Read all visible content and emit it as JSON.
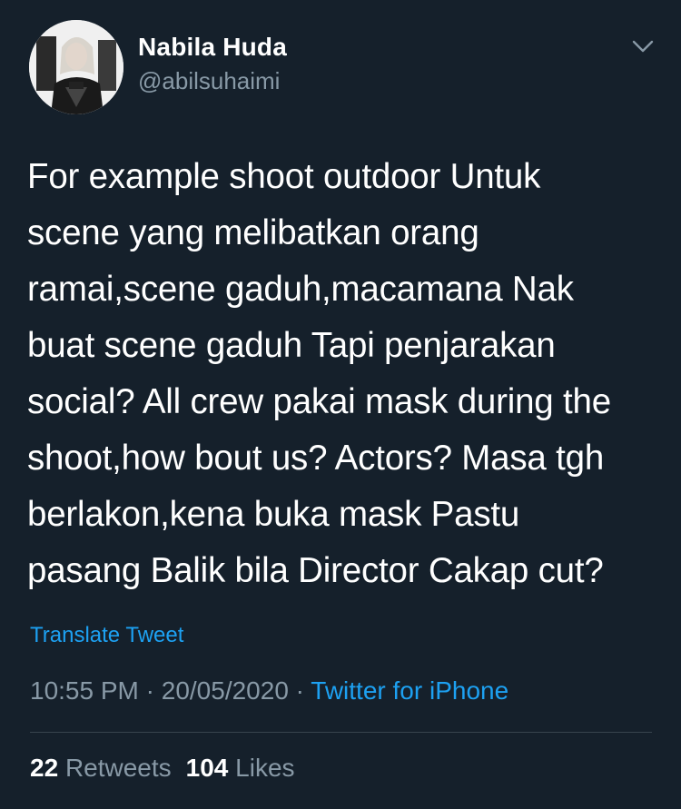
{
  "user": {
    "display_name": "Nabila Huda",
    "handle": "@abilsuhaimi",
    "avatar_icon": "profile-photo"
  },
  "menu": {
    "icon": "chevron-down-icon"
  },
  "tweet": {
    "text": "For example shoot outdoor Untuk\nscene yang melibatkan orang\nramai,scene gaduh,macamana Nak\nbuat scene gaduh Tapi penjarakan\nsocial? All crew pakai mask during the\nshoot,how bout us? Actors? Masa tgh\nberlakon,kena buka mask Pastu\npasang Balik bila Director Cakap cut?",
    "translate_label": "Translate Tweet"
  },
  "meta": {
    "time": "10:55 PM",
    "separator": " · ",
    "date": "20/05/2020",
    "separator2": " · ",
    "source": "Twitter for iPhone"
  },
  "stats": {
    "retweets_count": "22",
    "retweets_label": "Retweets",
    "likes_count": "104",
    "likes_label": "Likes"
  },
  "colors": {
    "background": "#15202b",
    "text_primary": "#ffffff",
    "text_secondary": "#8899a6",
    "accent": "#1da1f2",
    "divider": "#38444d"
  }
}
